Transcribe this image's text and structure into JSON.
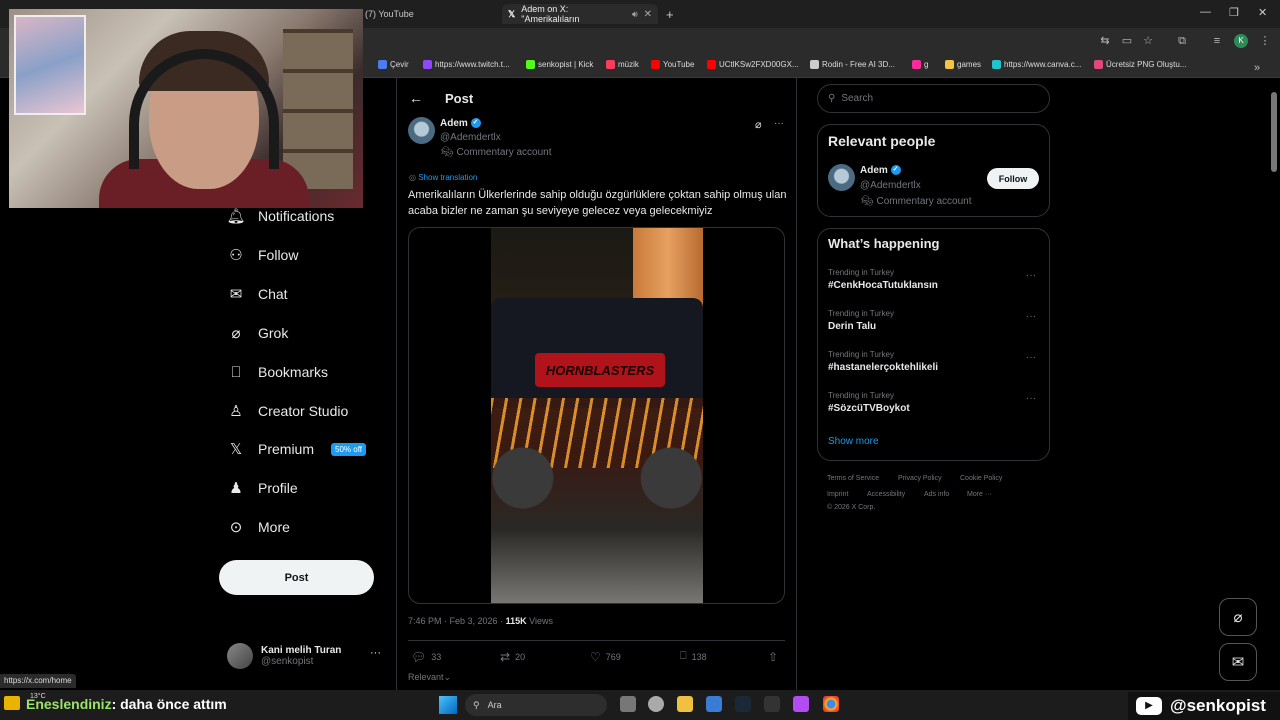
{
  "browser": {
    "tabs": [
      {
        "label": "(7) YouTube"
      },
      {
        "label": "Adem on X: \"Amerikalıların"
      }
    ],
    "bookmarks": [
      {
        "label": "Çevir",
        "color": "#4a7ef0"
      },
      {
        "label": "https://www.twitch.t...",
        "color": "#9146ff"
      },
      {
        "label": "senkopist | Kick",
        "color": "#53fc18"
      },
      {
        "label": "müzik",
        "color": "#ff3b5c"
      },
      {
        "label": "YouTube",
        "color": "#ff0000"
      },
      {
        "label": "UCtlKSw2FXD00GX...",
        "color": "#ff0000"
      },
      {
        "label": "Rodin - Free AI 3D...",
        "color": "#cccccc"
      },
      {
        "label": "g",
        "color": "#ff2a9a"
      },
      {
        "label": "games",
        "color": "#f4c542"
      },
      {
        "label": "https://www.canva.c...",
        "color": "#20c4cb"
      },
      {
        "label": "Ücretsiz PNG Oluştu...",
        "color": "#e0487a"
      }
    ],
    "status_url": "https://x.com/home"
  },
  "nav": {
    "items": [
      {
        "label": "Notifications",
        "icon": "bell-icon"
      },
      {
        "label": "Follow",
        "icon": "person-plus-icon"
      },
      {
        "label": "Chat",
        "icon": "mail-icon"
      },
      {
        "label": "Grok",
        "icon": "grok-icon"
      },
      {
        "label": "Bookmarks",
        "icon": "bookmark-icon"
      },
      {
        "label": "Creator Studio",
        "icon": "creator-icon"
      },
      {
        "label": "Premium",
        "icon": "x-logo-icon"
      },
      {
        "label": "Profile",
        "icon": "person-icon"
      },
      {
        "label": "More",
        "icon": "more-circle-icon"
      }
    ],
    "premium_badge": "50% off",
    "post_button": "Post",
    "account": {
      "name": "Kani melih Turan",
      "handle": "@senkopist"
    }
  },
  "post": {
    "header": "Post",
    "author_name": "Adem",
    "author_handle": "@Ademdertlx",
    "author_label": "Commentary account",
    "show_translation": "Show translation",
    "text": "Amerikalıların Ülkerlerinde sahip olduğu özgürlüklere çoktan sahip olmuş ulan acaba bizler ne zaman şu seviyeye gelecez veya gelecekmiyiz",
    "video_sign": "HORNBLASTERS",
    "timestamp": "7:46 PM · Feb 3, 2026 ·",
    "views_count": "115K",
    "views_label": "Views",
    "replies": "33",
    "reposts": "20",
    "likes": "769",
    "bookmarks": "138",
    "relevant_dropdown": "Relevant"
  },
  "sidebar": {
    "search_placeholder": "Search",
    "relevant_title": "Relevant people",
    "person": {
      "name": "Adem",
      "handle": "@Ademdertlx",
      "label": "Commentary account",
      "follow": "Follow"
    },
    "happening_title": "What’s happening",
    "trends": [
      {
        "context": "Trending in Turkey",
        "topic": "#CenkHocaTutuklansın"
      },
      {
        "context": "Trending in Turkey",
        "topic": "Derin Talu"
      },
      {
        "context": "Trending in Turkey",
        "topic": "#hastanelerçoktehlikeli"
      },
      {
        "context": "Trending in Turkey",
        "topic": "#SözcüTVBoykot"
      }
    ],
    "show_more": "Show more",
    "footer": [
      "Terms of Service",
      "Privacy Policy",
      "Cookie Policy",
      "Imprint",
      "Accessibility",
      "Ads info",
      "More ···",
      "© 2026 X Corp."
    ]
  },
  "overlay": {
    "chat_user": "Eneslendiniz",
    "chat_message": ": daha önce attım",
    "channel": "@senkopist",
    "weather": "13°C"
  },
  "taskbar": {
    "search": "Ara"
  }
}
